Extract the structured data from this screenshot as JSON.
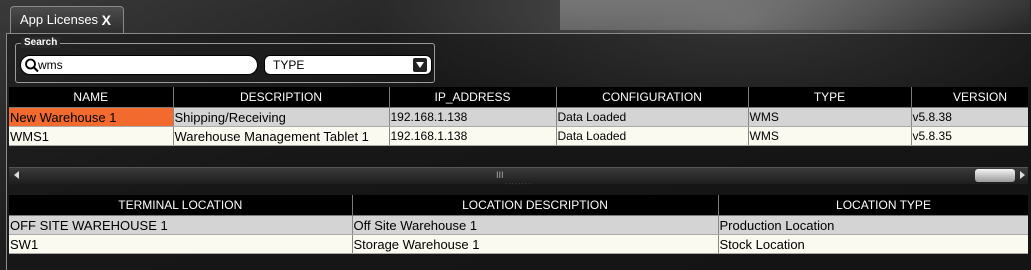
{
  "tab": {
    "label": "App Licenses",
    "close": "X"
  },
  "search": {
    "legend": "Search",
    "query": "wms",
    "type_selected": "TYPE"
  },
  "licenses": {
    "columns": [
      "NAME",
      "DESCRIPTION",
      "IP_ADDRESS",
      "CONFIGURATION",
      "TYPE",
      "VERSION"
    ],
    "rows": [
      [
        "New Warehouse 1",
        "Shipping/Receiving",
        "192.168.1.138",
        "Data Loaded",
        "WMS",
        "v5.8.38"
      ],
      [
        "WMS1",
        "Warehouse Management Tablet 1",
        "192.168.1.138",
        "Data Loaded",
        "WMS",
        "v5.8.35"
      ]
    ],
    "selected_row": 0
  },
  "scrollbar": {
    "grip": "III"
  },
  "splitter": {
    "grip": "˙˙˙˙˙˙˙˙"
  },
  "locations": {
    "columns": [
      "TERMINAL LOCATION",
      "LOCATION DESCRIPTION",
      "LOCATION TYPE"
    ],
    "rows": [
      [
        "OFF SITE WAREHOUSE 1",
        "Off Site Warehouse 1",
        "Production Location"
      ],
      [
        "SW1",
        "Storage Warehouse 1",
        "Stock Location"
      ]
    ]
  },
  "colors": {
    "selected_cell": "#f26a2e",
    "row_odd": "#d4d4d4",
    "row_even": "#fbfaf0",
    "header": "#000000"
  }
}
